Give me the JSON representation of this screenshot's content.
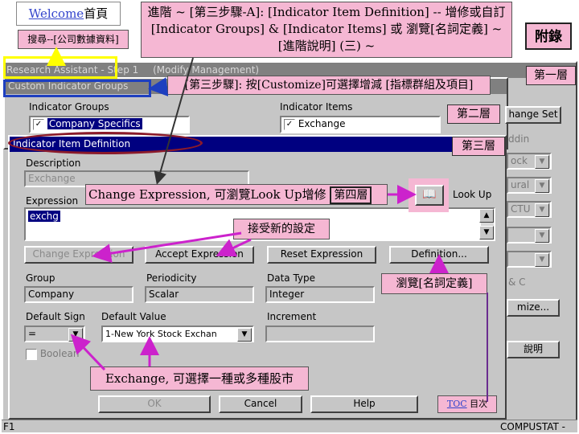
{
  "top": {
    "welcome_link": "Welcome",
    "home": "首頁",
    "search_note": "搜尋--[公司數據資料]",
    "heading": "進階 ~ [第三步驟-A]: [Indicator Item Definition] -- 增修或自訂 [Indicator Groups] & [Indicator Items] 或 瀏覽[名詞定義] ~ [進階說明] (三) ~",
    "appendix": "附錄"
  },
  "tags": {
    "level1": "第一層",
    "level2": "第二層",
    "level3": "第三層",
    "level4": "第四層"
  },
  "annotations": {
    "step3": "[第三步驟]: 按[Customize]可選擇增減 [指標群組及項目]",
    "change_expr": "Change Expression, 可瀏覽Look Up增修",
    "accept": "接受新的設定",
    "browse_def": "瀏覽[名詞定義]",
    "exchange": "Exchange, 可選擇一種或多種股市",
    "toc": "TOC",
    "toc_cn": "目次"
  },
  "bg_windows": {
    "research_title": "Research Assistant - Step 1",
    "modify_title": "(Modify Management)",
    "custom_title": "Custom Indicator Groups",
    "groups_label": "Indicator Groups",
    "groups_item": "Company Specifics",
    "items_label": "Indicator Items",
    "items_item": "Exchange",
    "change_set": "hange Set",
    "right_frags": [
      "ddin",
      "ock",
      "ural",
      "CTU",
      "",
      "",
      "& C",
      "mize..."
    ],
    "help_btn": "說明",
    "status_left": "F1",
    "status_right": "COMPUSTAT -"
  },
  "dialog": {
    "title": "Indicator Item Definition",
    "description_label": "Description",
    "description_value": "Exchange",
    "expression_label": "Expression",
    "expression_value": "exchg",
    "lookup_label": "Look Up",
    "buttons": {
      "change": "Change Expression",
      "accept": "Accept Expression",
      "reset": "Reset Expression",
      "definition": "Definition..."
    },
    "group_label": "Group",
    "group_value": "Company",
    "periodicity_label": "Periodicity",
    "periodicity_value": "Scalar",
    "datatype_label": "Data Type",
    "datatype_value": "Integer",
    "default_sign_label": "Default Sign",
    "default_sign_value": "=",
    "default_value_label": "Default Value",
    "default_value_value": "1-New York Stock Exchan",
    "increment_label": "Increment",
    "boolean_label": "Boolean",
    "ok": "OK",
    "cancel": "Cancel",
    "help": "Help"
  },
  "colors": {
    "annotation_pink": "#f5b7d3",
    "highlight_yellow": "#ffff00",
    "highlight_blue": "#1e3fbf",
    "highlight_maroon": "#8b1a2a",
    "arrow_magenta": "#cc22cc",
    "arrow_purple": "#6a2c8f",
    "arrow_dark": "#333333",
    "win_grey": "#c6c6c6",
    "title_blue": "#000080"
  }
}
